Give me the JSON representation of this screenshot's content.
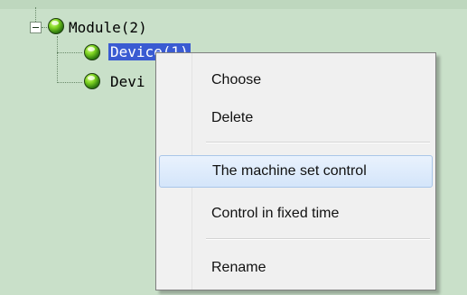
{
  "tree": {
    "root": {
      "label": "Module(2)",
      "expanded": true
    },
    "children": [
      {
        "label": "Devi",
        "full_label": "Device(1)",
        "selected": true
      },
      {
        "label": "Devi",
        "full_label": "Device",
        "selected": false
      }
    ]
  },
  "context_menu": {
    "items": [
      {
        "label": "Choose"
      },
      {
        "label": "Delete"
      },
      {
        "label": "The machine set control",
        "highlighted": true
      },
      {
        "label": "Control in fixed time"
      },
      {
        "label": "Rename"
      }
    ]
  },
  "colors": {
    "tree_background": "#c9e0c9",
    "selection": "#3a5bd2",
    "menu_background": "#f0f0f0",
    "menu_highlight": "#d4e5fa"
  }
}
